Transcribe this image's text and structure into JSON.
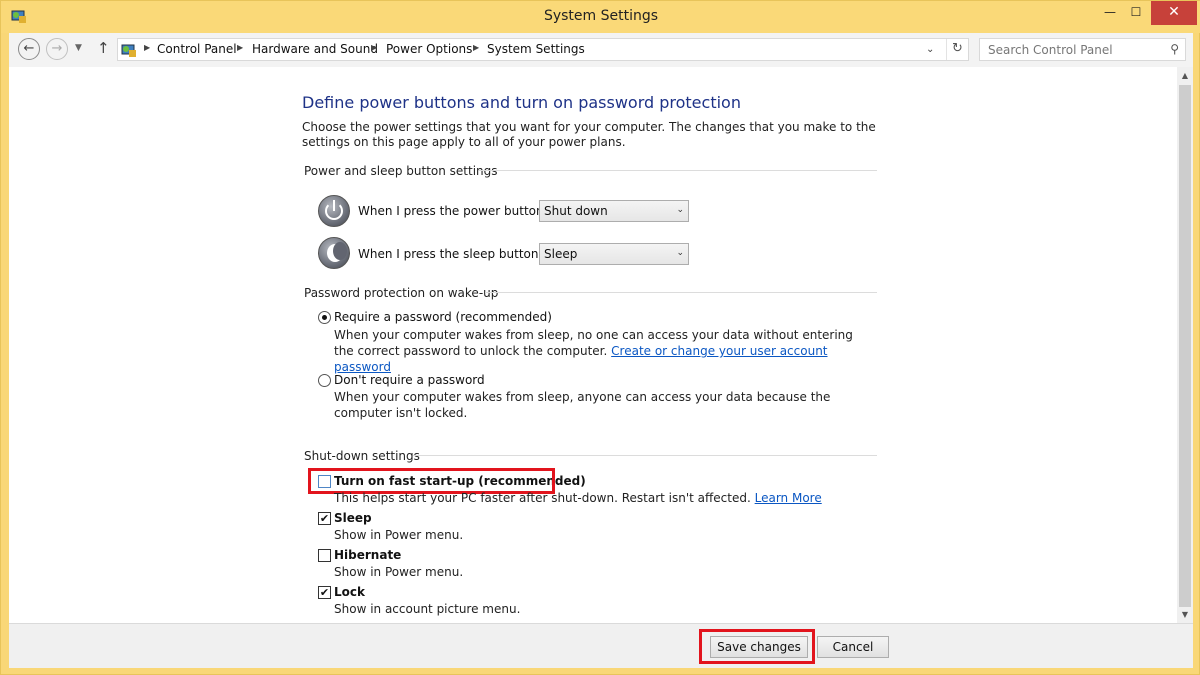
{
  "window": {
    "title": "System Settings"
  },
  "nav": {
    "breadcrumbs": [
      "Control Panel",
      "Hardware and Sound",
      "Power Options",
      "System Settings"
    ],
    "search_placeholder": "Search Control Panel"
  },
  "page": {
    "title": "Define power buttons and turn on password protection",
    "description": "Choose the power settings that you want for your computer. The changes that you make to the settings on this page apply to all of your power plans."
  },
  "power_sleep": {
    "heading": "Power and sleep button settings",
    "power_button_label": "When I press the power button:",
    "power_button_value": "Shut down",
    "sleep_button_label": "When I press the sleep button:",
    "sleep_button_value": "Sleep"
  },
  "password": {
    "heading": "Password protection on wake-up",
    "require_label": "Require a password (recommended)",
    "require_desc": "When your computer wakes from sleep, no one can access your data without entering the correct password to unlock the computer.",
    "require_link": "Create or change your user account password",
    "require_selected": true,
    "no_require_label": "Don't require a password",
    "no_require_desc": "When your computer wakes from sleep, anyone can access your data because the computer isn't locked.",
    "no_require_selected": false
  },
  "shutdown": {
    "heading": "Shut-down settings",
    "fast_startup_label": "Turn on fast start-up (recommended)",
    "fast_startup_desc": "This helps start your PC faster after shut-down. Restart isn't affected.",
    "fast_startup_link": "Learn More",
    "fast_startup_checked": false,
    "sleep_label": "Sleep",
    "sleep_desc": "Show in Power menu.",
    "sleep_checked": true,
    "hibernate_label": "Hibernate",
    "hibernate_desc": "Show in Power menu.",
    "hibernate_checked": false,
    "lock_label": "Lock",
    "lock_desc": "Show in account picture menu.",
    "lock_checked": true
  },
  "footer": {
    "save_label": "Save changes",
    "cancel_label": "Cancel"
  },
  "icons": {
    "check": "✔",
    "minimize": "—",
    "maximize": "☐",
    "close": "✕",
    "back": "←",
    "forward": "→",
    "dropdown": "▼",
    "up": "↑",
    "chevron": "▶",
    "address_dropdown": "⌄",
    "refresh": "↻",
    "search": "⚲",
    "scroll_up": "▲",
    "scroll_down": "▼",
    "select_arrow": "⌄"
  },
  "colors": {
    "accent_highlight": "#e2141d",
    "link": "#0b57c3",
    "title": "#1e3287",
    "frame": "#f9d777"
  }
}
